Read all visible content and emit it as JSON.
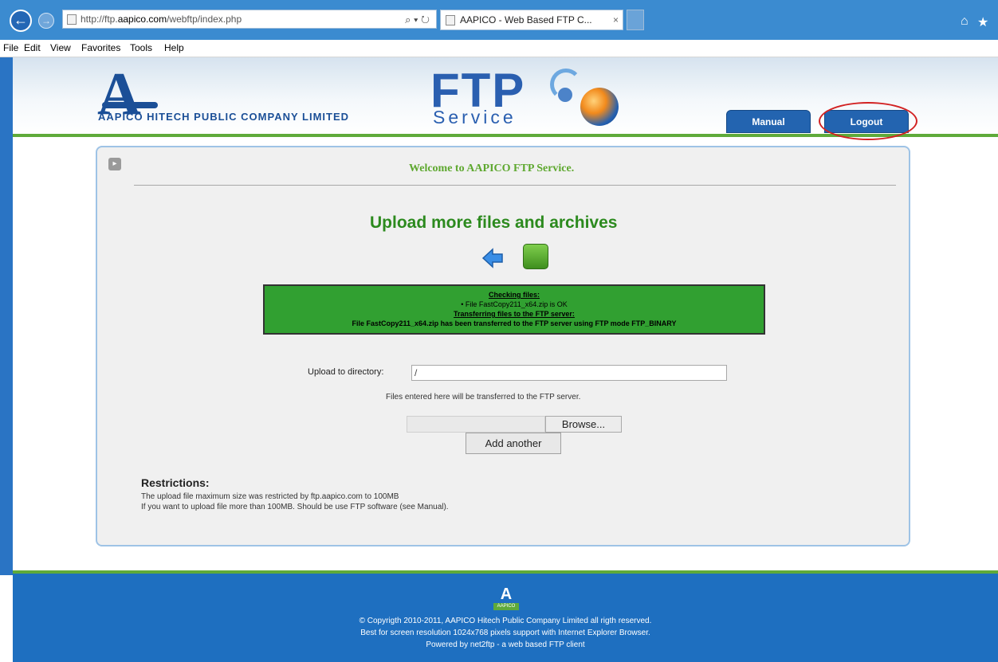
{
  "browser": {
    "url_prefix": "http://ftp.",
    "url_domain": "aapico.com",
    "url_suffix": "/webftp/index.php",
    "addr_tools": "⌕ ▾ ↻",
    "tab_title": "AAPICO - Web Based FTP C...",
    "tab_close": "×",
    "menu": [
      "File",
      "Edit",
      "View",
      "Favorites",
      "Tools",
      "Help"
    ]
  },
  "header": {
    "logo_letter": "A",
    "company_name": "AAPICO HITECH PUBLIC COMPANY LIMITED",
    "ftp_text": "FTP",
    "service_text": "Service",
    "manual_label": "Manual",
    "logout_label": "Logout"
  },
  "main": {
    "welcome": "Welcome to AAPICO FTP Service.",
    "upload_title": "Upload more files and archives",
    "status": {
      "checking_heading": "Checking files:",
      "check_line": "• File FastCopy211_x64.zip is OK",
      "transfer_heading": "Transferring files to the FTP server:",
      "transfer_line": "File FastCopy211_x64.zip has been transferred to the FTP server using FTP mode FTP_BINARY"
    },
    "dir_label": "Upload to directory:",
    "dir_value": "/",
    "files_note": "Files entered here will be transferred to the FTP server.",
    "browse_label": "Browse...",
    "add_another_label": "Add another",
    "restrictions_title": "Restrictions:",
    "restriction_line1": "The upload file maximum size was restricted by ftp.aapico.com to 100MB",
    "restriction_line2": "If you want to upload file more than 100MB. Should be use FTP software (see Manual)."
  },
  "footer": {
    "logo_letter": "A",
    "logo_sub": "AAPICO",
    "line1": "© Copyrigth 2010-2011, AAPICO Hitech Public Company Limited all rigth reserved.",
    "line2": "Best for screen resolution 1024x768 pixels support with Internet Explorer Browser.",
    "line3": "Powered by net2ftp - a web based FTP client"
  },
  "colors": {
    "accent_blue": "#2364b0",
    "accent_green": "#5faa3a",
    "status_green": "#31a031",
    "highlight_red": "#d22222"
  }
}
